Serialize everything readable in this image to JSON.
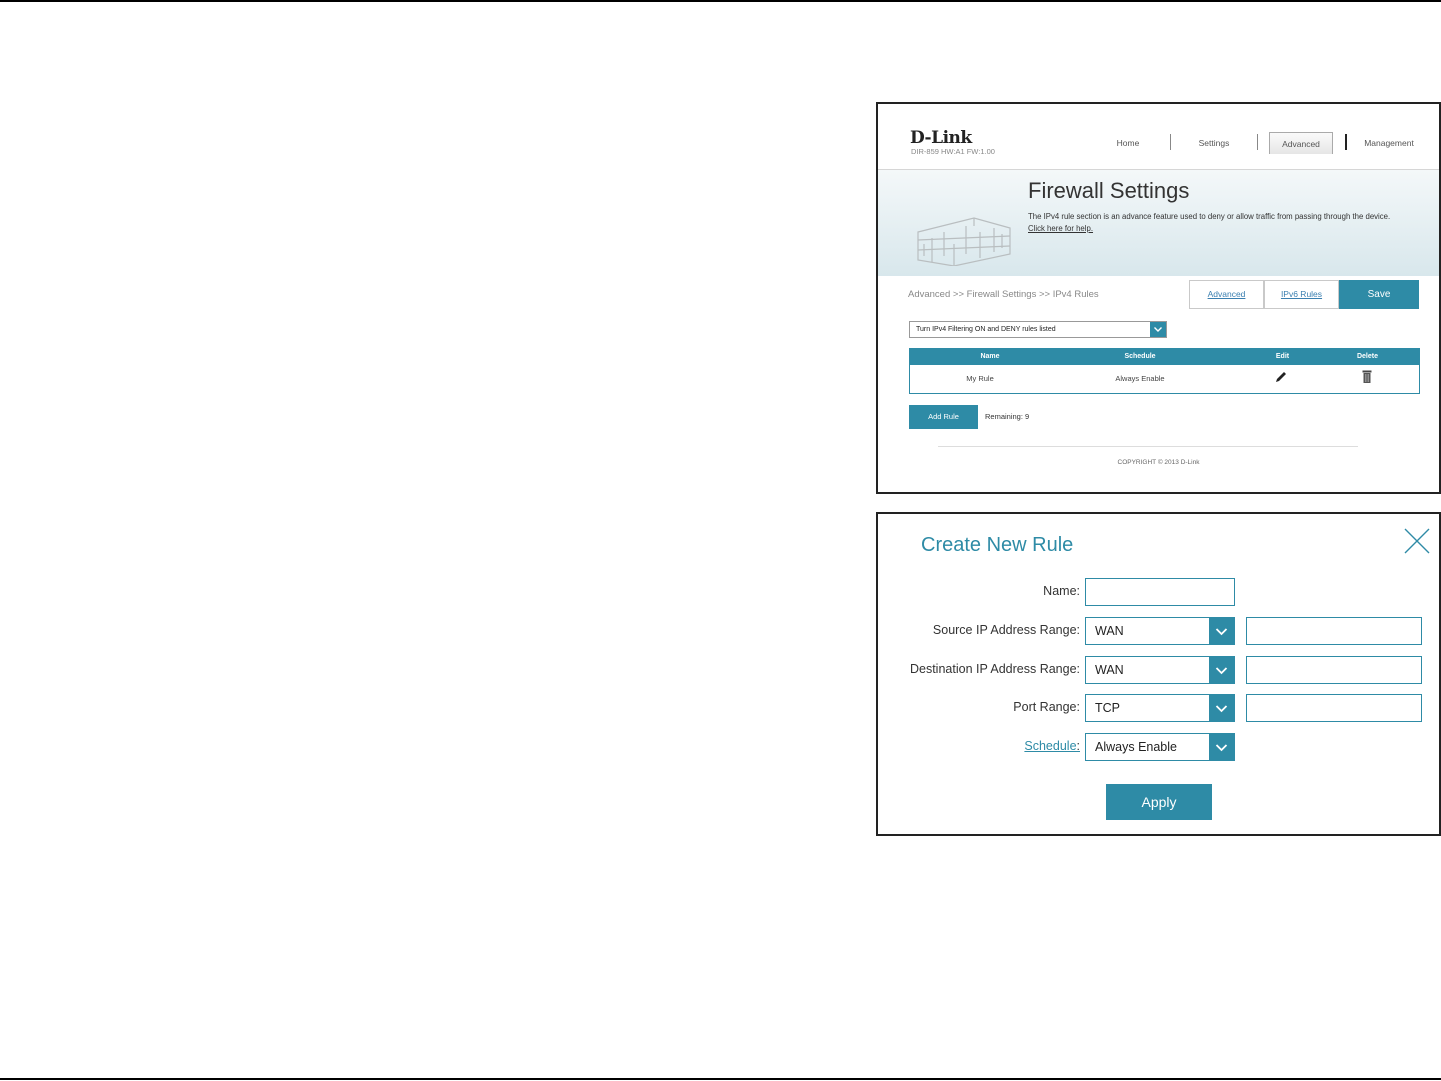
{
  "firewall_page": {
    "logo": "D-Link",
    "model_info": "DIR-859    HW:A1    FW:1.00",
    "nav": {
      "home": "Home",
      "settings": "Settings",
      "advanced": "Advanced",
      "management": "Management"
    },
    "title": "Firewall Settings",
    "description": "The IPv4 rule section is an advance feature used to deny or allow traffic from passing through the device.",
    "help_link": "Click here for help.",
    "breadcrumb": "Advanced >> Firewall Settings >> IPv4 Rules",
    "tabs": {
      "advanced": "Advanced",
      "ipv6_rules": "IPv6 Rules",
      "save": "Save"
    },
    "filter_select": "Turn IPv4 Filtering ON and DENY rules listed",
    "table": {
      "columns": [
        "Name",
        "Schedule",
        "Edit",
        "Delete"
      ],
      "rows": [
        {
          "name": "My Rule",
          "schedule": "Always Enable"
        }
      ]
    },
    "add_rule": "Add Rule",
    "remaining": "Remaining: 9",
    "copyright": "COPYRIGHT © 2013 D-Link"
  },
  "create_rule_dialog": {
    "title": "Create New Rule",
    "fields": {
      "name_label": "Name:",
      "source_label": "Source IP Address Range:",
      "source_value": "WAN",
      "destination_label": "Destination IP Address Range:",
      "destination_value": "WAN",
      "port_label": "Port Range:",
      "port_value": "TCP",
      "schedule_label": "Schedule",
      "schedule_colon": ":",
      "schedule_value": "Always Enable"
    },
    "apply": "Apply"
  },
  "colors": {
    "accent": "#2e8ba6",
    "link": "#3a7fb0"
  },
  "icons": {
    "edit": "pencil-icon",
    "delete": "trash-icon",
    "close": "close-icon",
    "dropdown": "chevron-down-icon",
    "banner": "firewall-brick-wall-icon"
  }
}
